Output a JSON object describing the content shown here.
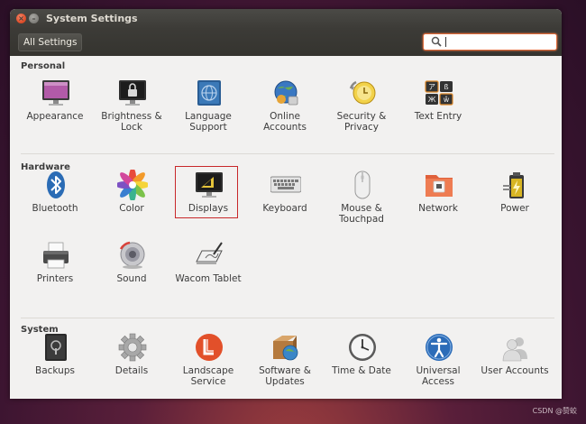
{
  "window": {
    "title": "System Settings"
  },
  "toolbar": {
    "all_settings_label": "All Settings",
    "search_value": ""
  },
  "sections": {
    "personal": {
      "title": "Personal",
      "items": [
        {
          "label": "Appearance",
          "icon": "appearance-icon"
        },
        {
          "label": "Brightness &\nLock",
          "icon": "brightness-lock-icon"
        },
        {
          "label": "Language\nSupport",
          "icon": "language-support-icon"
        },
        {
          "label": "Online\nAccounts",
          "icon": "online-accounts-icon"
        },
        {
          "label": "Security &\nPrivacy",
          "icon": "security-privacy-icon"
        },
        {
          "label": "Text Entry",
          "icon": "text-entry-icon"
        }
      ]
    },
    "hardware": {
      "title": "Hardware",
      "items": [
        {
          "label": "Bluetooth",
          "icon": "bluetooth-icon"
        },
        {
          "label": "Color",
          "icon": "color-icon"
        },
        {
          "label": "Displays",
          "icon": "displays-icon",
          "highlighted": true
        },
        {
          "label": "Keyboard",
          "icon": "keyboard-icon"
        },
        {
          "label": "Mouse &\nTouchpad",
          "icon": "mouse-touchpad-icon"
        },
        {
          "label": "Network",
          "icon": "network-icon"
        },
        {
          "label": "Power",
          "icon": "power-icon"
        },
        {
          "label": "Printers",
          "icon": "printers-icon"
        },
        {
          "label": "Sound",
          "icon": "sound-icon"
        },
        {
          "label": "Wacom Tablet",
          "icon": "wacom-tablet-icon"
        }
      ]
    },
    "system": {
      "title": "System",
      "items": [
        {
          "label": "Backups",
          "icon": "backups-icon"
        },
        {
          "label": "Details",
          "icon": "details-icon"
        },
        {
          "label": "Landscape\nService",
          "icon": "landscape-service-icon"
        },
        {
          "label": "Software &\nUpdates",
          "icon": "software-updates-icon"
        },
        {
          "label": "Time & Date",
          "icon": "time-date-icon"
        },
        {
          "label": "Universal\nAccess",
          "icon": "universal-access-icon"
        },
        {
          "label": "User Accounts",
          "icon": "user-accounts-icon"
        }
      ]
    }
  },
  "watermark": "CSDN @赞蛟",
  "colors": {
    "highlight_border": "#c8282a",
    "search_focus": "#e06b3a"
  }
}
